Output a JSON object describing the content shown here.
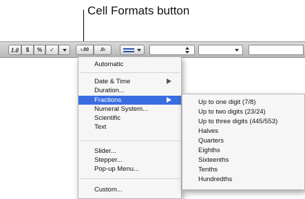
{
  "callout": {
    "label": "Cell Formats button"
  },
  "toolbar": {
    "italic_btn": "1.0",
    "currency_btn": "$",
    "percent_btn": "%",
    "checkbox_btn": "✓",
    "dec_decimals_btn": "⁠←.00",
    "inc_decimals_btn": ".0→"
  },
  "menu": {
    "items": [
      {
        "label": "Automatic"
      },
      {
        "label": "Date & Time"
      },
      {
        "label": "Duration..."
      },
      {
        "label": "Fractions"
      },
      {
        "label": "Numeral System..."
      },
      {
        "label": "Scientific"
      },
      {
        "label": "Text"
      },
      {
        "label": "Slider..."
      },
      {
        "label": "Stepper..."
      },
      {
        "label": "Pop-up Menu..."
      },
      {
        "label": "Custom..."
      }
    ],
    "selected": "Fractions"
  },
  "submenu": {
    "items": [
      {
        "label": "Up to one digit (7/8)"
      },
      {
        "label": "Up to two digits (23/24)"
      },
      {
        "label": "Up to three digits (445/553)"
      },
      {
        "label": "Halves"
      },
      {
        "label": "Quarters"
      },
      {
        "label": "Eighths"
      },
      {
        "label": "Sixteenths"
      },
      {
        "label": "Tenths"
      },
      {
        "label": "Hundredths"
      }
    ]
  }
}
